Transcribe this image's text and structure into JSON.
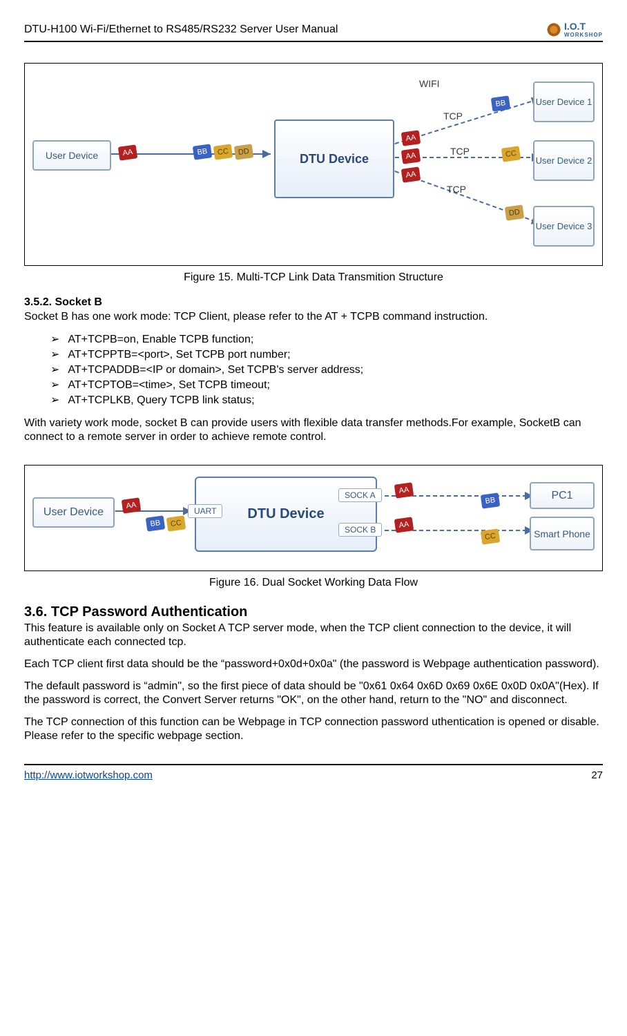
{
  "header": {
    "title": "DTU-H100  Wi-Fi/Ethernet to RS485/RS232  Server User Manual",
    "logo_main": "I.O.T",
    "logo_sub": "WORKSHOP"
  },
  "fig15": {
    "caption": "Figure 15.    Multi-TCP Link Data Transmition Structure",
    "user_device": "User Device",
    "dtu": "DTU Device",
    "user1": "User Device 1",
    "user2": "User Device 2",
    "user3": "User Device 3",
    "wifi": "WIFI",
    "tcp": "TCP",
    "aa": "AA",
    "bb": "BB",
    "cc": "CC",
    "dd": "DD"
  },
  "sec352": {
    "heading": "3.5.2.    Socket B",
    "intro": "Socket B has one work mode: TCP Client, please refer to the AT + TCPB command instruction.",
    "cmds": [
      "AT+TCPB=on,            Enable TCPB function;",
      "AT+TCPPTB=<port>, Set TCPB port number;",
      "AT+TCPADDB=<IP or domain>, Set TCPB's server address;",
      "AT+TCPTOB=<time>,   Set TCPB timeout;",
      "AT+TCPLKB,        Query TCPB link status;"
    ],
    "para2": "With variety work mode, socket B can provide users with flexible data transfer methods.For example, SocketB can connect to a remote server in order to achieve remote control."
  },
  "fig16": {
    "caption": "Figure 16.    Dual Socket Working Data Flow",
    "user_device": "User Device",
    "dtu": "DTU Device",
    "uart": "UART",
    "socka": "SOCK A",
    "sockb": "SOCK B",
    "pc1": "PC1",
    "phone": "Smart Phone",
    "aa": "AA",
    "bb": "BB",
    "cc": "CC"
  },
  "sec36": {
    "heading": "3.6.  TCP Password Authentication",
    "p1": "This feature is available only on Socket A TCP server mode, when the TCP client connection to the device, it will authenticate each connected tcp.",
    "p2": "Each TCP client first data should be the “password+0x0d+0x0a\" (the password is Webpage authentication password).",
    "p3": "The default password is “admin\", so the first piece of data should be \"0x61 0x64 0x6D 0x69 0x6E 0x0D 0x0A\"(Hex). If the password is correct, the Convert Server returns \"OK\", on the other hand, return to the \"NO\" and disconnect.",
    "p4": "The TCP connection of this function can be Webpage in TCP connection password uthentication is opened or disable. Please refer to the specific webpage section."
  },
  "footer": {
    "url": "http://www.iotworkshop.com",
    "page": "27"
  }
}
